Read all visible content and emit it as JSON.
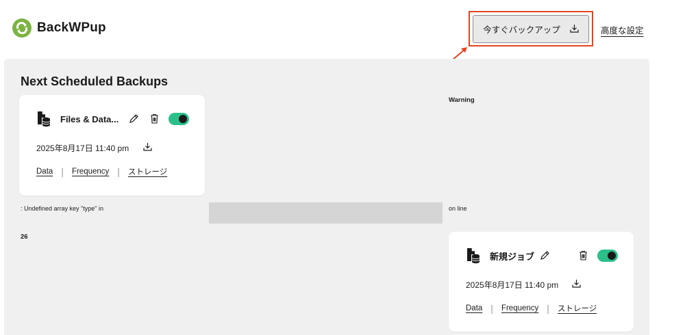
{
  "header": {
    "logo_text": "BackWPup",
    "backup_now_label": "今すぐバックアップ",
    "advanced_settings_label": "高度な設定",
    "highlight_color": "#e5421d"
  },
  "panel": {
    "title": "Next Scheduled Backups",
    "warning_label": "Warning",
    "error_message": ": Undefined array key \"type\" in",
    "on_line_label": "on line",
    "line_number": "26"
  },
  "jobs": [
    {
      "name": "Files & Data...",
      "date": "2025年8月17日 11:40 pm",
      "enabled": true,
      "links": [
        "Data",
        "Frequency",
        "ストレージ"
      ]
    },
    {
      "name": "新規ジョブ",
      "date": "2025年8月17日 11:40 pm",
      "enabled": true,
      "links": [
        "Data",
        "Frequency",
        "ストレージ"
      ]
    }
  ],
  "icons": {
    "logo": "backwpup-logo-icon",
    "download": "download-icon",
    "edit": "pencil-icon",
    "delete": "trash-icon",
    "job": "file-database-icon"
  },
  "colors": {
    "toggle_on": "#2bbf8a",
    "panel_bg": "#f0f0f0",
    "logo_green": "#7cb342"
  }
}
